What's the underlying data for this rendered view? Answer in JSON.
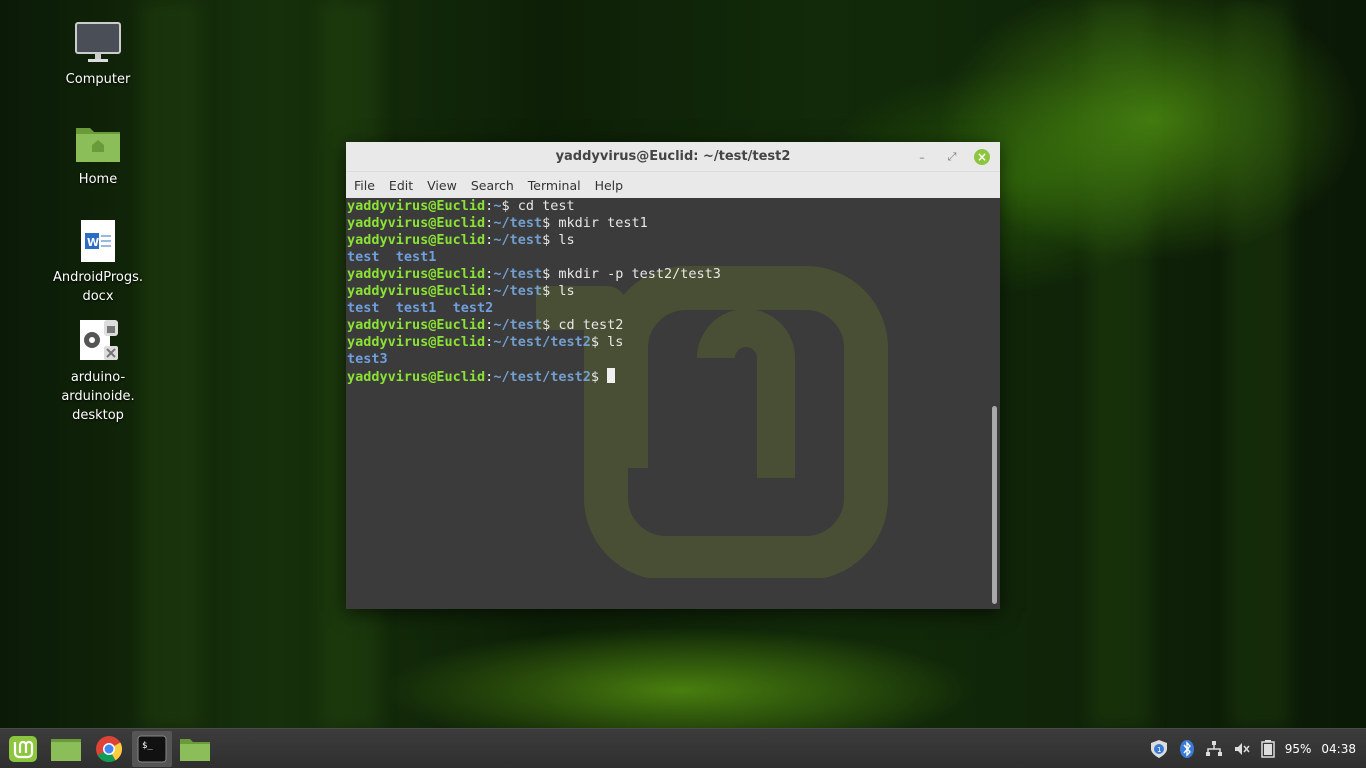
{
  "desktop": {
    "icons": [
      {
        "label": "Computer",
        "icon": "computer-icon"
      },
      {
        "label": "Home",
        "icon": "home-folder-icon"
      },
      {
        "label_line1": "AndroidProgs.",
        "label_line2": "docx",
        "icon": "word-document-icon"
      },
      {
        "label_line1": "arduino-",
        "label_line2": "arduinoide.",
        "label_line3": "desktop",
        "icon": "desktop-file-icon"
      }
    ]
  },
  "window": {
    "title": "yaddyvirus@Euclid: ~/test/test2",
    "menu": [
      "File",
      "Edit",
      "View",
      "Search",
      "Terminal",
      "Help"
    ]
  },
  "terminal": {
    "user": "yaddyvirus@Euclid",
    "lines": [
      {
        "path": "~",
        "cmd": "cd test"
      },
      {
        "path": "~/test",
        "cmd": "mkdir test1"
      },
      {
        "path": "~/test",
        "cmd": "ls"
      },
      {
        "output": "test  test1"
      },
      {
        "path": "~/test",
        "cmd": "mkdir -p test2/test3"
      },
      {
        "path": "~/test",
        "cmd": "ls"
      },
      {
        "output": "test  test1  test2"
      },
      {
        "path": "~/test",
        "cmd": "cd test2"
      },
      {
        "path": "~/test/test2",
        "cmd": "ls"
      },
      {
        "output": "test3"
      },
      {
        "path": "~/test/test2",
        "cmd": ""
      }
    ]
  },
  "taskbar": {
    "apps": [
      "mint-menu-icon",
      "files-icon",
      "chrome-icon",
      "terminal-icon",
      "folder-icon"
    ],
    "battery": "95%",
    "clock": "04:38"
  },
  "colors": {
    "prompt_user": "#8ae234",
    "prompt_path": "#729fcf",
    "accent": "#8cc63e"
  }
}
